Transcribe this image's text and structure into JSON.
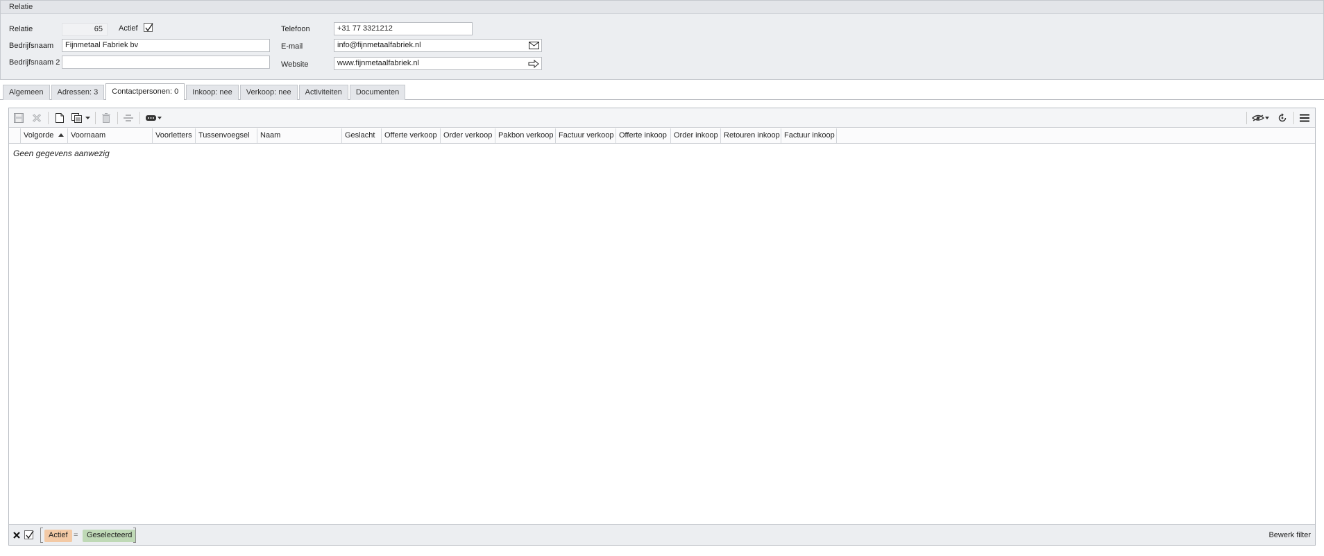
{
  "header": {
    "title": "Relatie",
    "relatie_label": "Relatie",
    "relatie_value": "65",
    "actief_label": "Actief",
    "actief_checked": true,
    "bedrijfsnaam_label": "Bedrijfsnaam",
    "bedrijfsnaam_value": "Fijnmetaal Fabriek bv",
    "bedrijfsnaam2_label": "Bedrijfsnaam 2",
    "bedrijfsnaam2_value": "",
    "telefoon_label": "Telefoon",
    "telefoon_value": "+31 77 3321212",
    "email_label": "E-mail",
    "email_value": "info@fijnmetaalfabriek.nl",
    "website_label": "Website",
    "website_value": "www.fijnmetaalfabriek.nl"
  },
  "tabs": [
    {
      "label": "Algemeen",
      "active": false
    },
    {
      "label": "Adressen: 3",
      "active": false
    },
    {
      "label": "Contactpersonen: 0",
      "active": true
    },
    {
      "label": "Inkoop: nee",
      "active": false
    },
    {
      "label": "Verkoop: nee",
      "active": false
    },
    {
      "label": "Activiteiten",
      "active": false
    },
    {
      "label": "Documenten",
      "active": false
    }
  ],
  "grid": {
    "columns": [
      "Volgorde",
      "Voornaam",
      "Voorletters",
      "Tussenvoegsel",
      "Naam",
      "Geslacht",
      "Offerte verkoop",
      "Order verkoop",
      "Pakbon verkoop",
      "Factuur verkoop",
      "Offerte inkoop",
      "Order inkoop",
      "Retouren inkoop",
      "Factuur inkoop"
    ],
    "sort_column": "Volgorde",
    "sort_direction": "ascending",
    "empty_message": "Geen gegevens aanwezig"
  },
  "filter": {
    "field": "Actief",
    "operator": "=",
    "value": "Geselecteerd",
    "edit_label": "Bewerk filter",
    "field_color": "#f3c9a5",
    "value_color": "#bfd9b6"
  },
  "colors": {
    "panel_bg": "#eceef1",
    "border": "#b7bbc1"
  }
}
